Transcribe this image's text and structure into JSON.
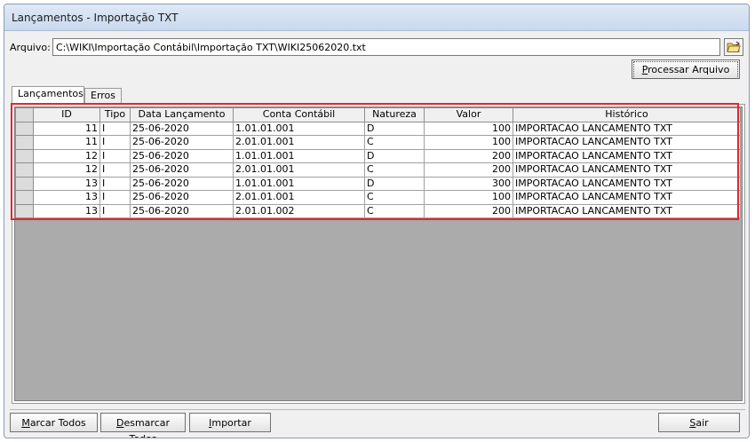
{
  "window": {
    "title": "Lançamentos - Importação TXT"
  },
  "arquivo": {
    "label": "Arquivo:",
    "value": "C:\\WIKI\\Importação Contábil\\Importação TXT\\WIKI25062020.txt"
  },
  "buttons": {
    "processar": "Processar Arquivo",
    "marcar": "Marcar Todos",
    "desmarcar": "Desmarcar Todos",
    "importar": "Importar",
    "sair": "Sair"
  },
  "tabs": [
    "Lançamentos",
    "Erros"
  ],
  "grid": {
    "columns": [
      "ID",
      "Tipo",
      "Data Lançamento",
      "Conta Contábil",
      "Natureza",
      "Valor",
      "Histórico"
    ],
    "rows": [
      [
        "11",
        "I",
        "25-06-2020",
        "1.01.01.001",
        "D",
        "100",
        "IMPORTACAO LANCAMENTO TXT"
      ],
      [
        "11",
        "I",
        "25-06-2020",
        "2.01.01.001",
        "C",
        "100",
        "IMPORTACAO LANCAMENTO TXT"
      ],
      [
        "12",
        "I",
        "25-06-2020",
        "1.01.01.001",
        "D",
        "200",
        "IMPORTACAO LANCAMENTO TXT"
      ],
      [
        "12",
        "I",
        "25-06-2020",
        "2.01.01.001",
        "C",
        "200",
        "IMPORTACAO LANCAMENTO TXT"
      ],
      [
        "13",
        "I",
        "25-06-2020",
        "1.01.01.001",
        "D",
        "300",
        "IMPORTACAO LANCAMENTO TXT"
      ],
      [
        "13",
        "I",
        "25-06-2020",
        "2.01.01.001",
        "C",
        "100",
        "IMPORTACAO LANCAMENTO TXT"
      ],
      [
        "13",
        "I",
        "25-06-2020",
        "2.01.01.002",
        "C",
        "200",
        "IMPORTACAO LANCAMENTO TXT"
      ]
    ]
  },
  "icons": {
    "browse": "open-folder-icon"
  },
  "colors": {
    "highlight": "#e3262c",
    "grid_background": "#ababab"
  }
}
